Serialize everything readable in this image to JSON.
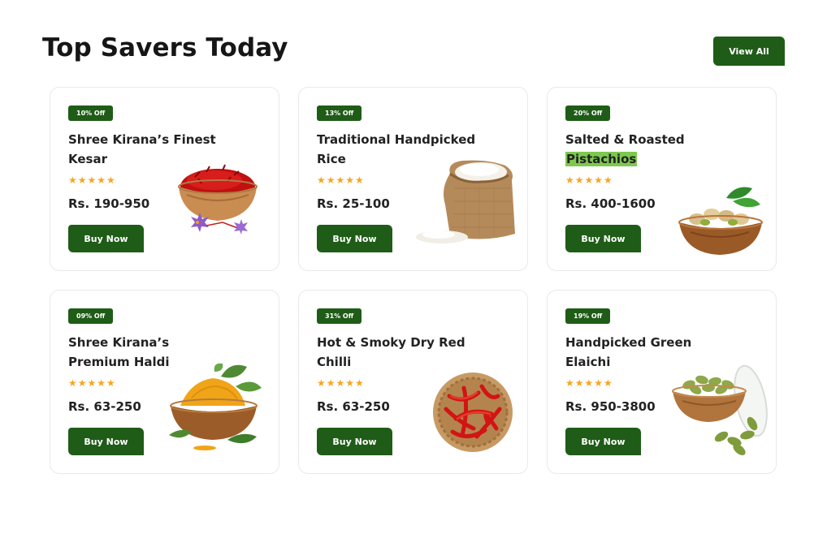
{
  "section": {
    "title": "Top Savers Today",
    "view_all_label": "View All"
  },
  "products": [
    {
      "badge": "10% Off",
      "title": "Shree Kirana’s Finest Kesar",
      "stars": "★★★★★",
      "rating": 5,
      "price": "Rs. 190-950",
      "button": "Buy Now",
      "image": "saffron-bowl"
    },
    {
      "badge": "13% Off",
      "title": "Traditional Handpicked Rice",
      "stars": "★★★★★",
      "rating": 5,
      "price": "Rs. 25-100",
      "button": "Buy Now",
      "image": "rice-sack"
    },
    {
      "badge": "20% Off",
      "title_plain": "Salted & Roasted",
      "title_highlight": "Pistachios",
      "stars": "★★★★★",
      "rating": 5,
      "price": "Rs. 400-1600",
      "button": "Buy Now",
      "image": "pistachio-bowl"
    },
    {
      "badge": "09% Off",
      "title": "Shree Kirana’s Premium Haldi",
      "stars": "★★★★★",
      "rating": 5,
      "price": "Rs. 63-250",
      "button": "Buy Now",
      "image": "turmeric-bowl"
    },
    {
      "badge": "31% Off",
      "title": "Hot & Smoky Dry Red Chilli",
      "stars": "★★★★★",
      "rating": 5,
      "price": "Rs. 63-250",
      "button": "Buy Now",
      "image": "red-chilli-basket"
    },
    {
      "badge": "19% Off",
      "title": "Handpicked Green Elaichi",
      "stars": "★★★★★",
      "rating": 5,
      "price": "Rs. 950-3800",
      "button": "Buy Now",
      "image": "cardamom-bowl"
    }
  ],
  "colors": {
    "brand_green": "#1f5c17",
    "star": "#f5a623",
    "highlight": "#7ec850"
  }
}
